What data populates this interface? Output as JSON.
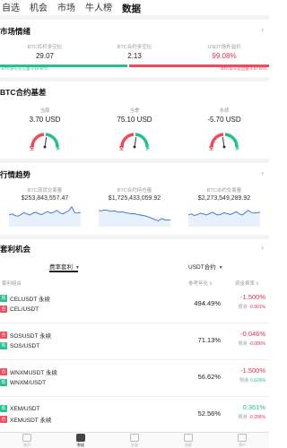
{
  "top_nav": {
    "tabs": [
      "自选",
      "机会",
      "市场",
      "牛人榜",
      "数据"
    ],
    "active_index": 4
  },
  "market_sentiment": {
    "title": "市场情绪",
    "stats": [
      {
        "label": "BTC杠杆多空比",
        "value": "29.07"
      },
      {
        "label": "BTC合约多空比",
        "value": "2.13"
      },
      {
        "label": "USDT场外溢价",
        "value": "99.08%"
      }
    ],
    "long_label": "BTC多头买入量 4.16 BTC",
    "short_label": "BTC多头卖出量 4.57 BTC",
    "long_volume_btc": 4.16,
    "short_volume_btc": 4.57,
    "colors": {
      "long": "#27c08a",
      "short": "#f24a5a"
    }
  },
  "basis": {
    "title": "BTC合约基差",
    "items": [
      {
        "label": "当周",
        "value": "3.70 USD",
        "level": 0.55
      },
      {
        "label": "当季",
        "value": "75.10 USD",
        "level": 0.55
      },
      {
        "label": "永续",
        "value": "-5.70 USD",
        "level": 0.45
      }
    ],
    "gauge_left": "空",
    "gauge_right": "多"
  },
  "trends": {
    "title": "行情趋势",
    "items": [
      {
        "label": "BTC现货交易量",
        "value": "$253,843,557.47",
        "sparkline": [
          0.5,
          0.55,
          0.48,
          0.45,
          0.52,
          0.6,
          0.55,
          0.5,
          0.58,
          0.62,
          0.55,
          0.52,
          0.6,
          0.65,
          0.58,
          0.62,
          0.7,
          0.6,
          0.55,
          0.62,
          0.68,
          0.85,
          0.6,
          0.58,
          0.62
        ]
      },
      {
        "label": "BTC合约持仓量",
        "value": "$1,725,433,059.92",
        "sparkline": [
          0.7,
          0.68,
          0.72,
          0.7,
          0.66,
          0.68,
          0.65,
          0.62,
          0.64,
          0.6,
          0.58,
          0.55,
          0.56,
          0.52,
          0.5,
          0.48,
          0.45,
          0.4,
          0.35,
          0.3,
          0.25,
          0.35,
          0.3,
          0.28,
          0.3
        ]
      },
      {
        "label": "BTC合约交易量",
        "value": "$2,273,549,289.92",
        "sparkline": [
          0.5,
          0.55,
          0.48,
          0.52,
          0.58,
          0.55,
          0.5,
          0.56,
          0.62,
          0.55,
          0.5,
          0.54,
          0.6,
          0.56,
          0.52,
          0.58,
          0.65,
          0.55,
          0.5,
          0.6,
          0.7,
          0.62,
          0.58,
          0.6,
          0.62
        ]
      }
    ]
  },
  "arbitrage": {
    "title": "套利机会",
    "selector_left": "费率套利",
    "selector_right": "USDT合约",
    "columns": [
      "套利组合",
      "参考年化",
      "资金费率"
    ],
    "pred_label": "预测",
    "rows": [
      {
        "tag": "现",
        "tag2": "合",
        "pair1": "CELUSDT 永续",
        "pair2": "CEL/USDT",
        "annual": "494.49%",
        "rate": "-1.500%",
        "rate_sign": "neg",
        "pred": "-0.901%",
        "pred_sign": "neg"
      },
      {
        "tag": "合",
        "tag2": "现",
        "pair1": "SOSUSDT 永续",
        "pair2": "SOS/USDT",
        "annual": "71.13%",
        "rate": "-0.046%",
        "rate_sign": "neg",
        "pred": "-0.086%",
        "pred_sign": "neg"
      },
      {
        "tag": "合",
        "tag2": "现",
        "pair1": "WNXMUSDT 永续",
        "pair2": "WNXM/USDT",
        "annual": "56.62%",
        "rate": "-1.500%",
        "rate_sign": "neg",
        "pred": "0.626%",
        "pred_sign": "pos"
      },
      {
        "tag": "现",
        "tag2": "合",
        "pair1": "XEM/USDT",
        "pair2": "XEMUSDT 永续",
        "annual": "52.56%",
        "rate": "0.361%",
        "rate_sign": "pos",
        "pred": "-0.206%",
        "pred_sign": "neg"
      },
      {
        "tag": "现",
        "tag2": "合",
        "pair1": "CQT/USDT",
        "pair2": "CQTUSDT 永续",
        "annual": "52.52%",
        "rate": "0.259%",
        "rate_sign": "pos",
        "pred": "0.126%",
        "pred_sign": "pos"
      }
    ]
  },
  "bottom_nav": {
    "tabs": [
      "首页",
      "数据",
      "交易",
      "消息",
      "资产"
    ],
    "active_index": 1
  }
}
